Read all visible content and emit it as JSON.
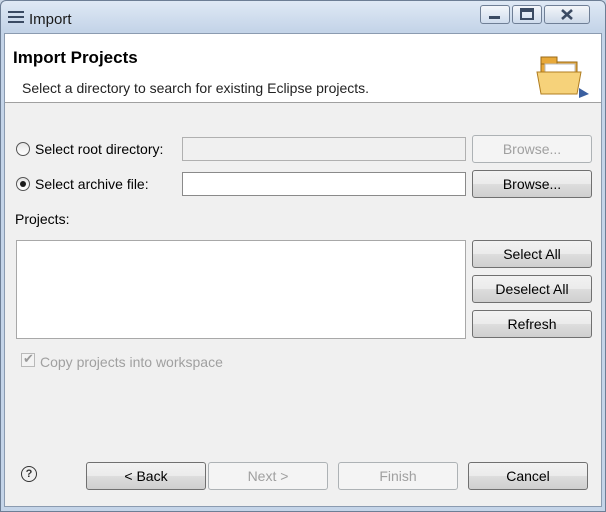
{
  "window": {
    "title": "Import"
  },
  "header": {
    "title": "Import Projects",
    "description": "Select a directory to search for existing Eclipse projects."
  },
  "root_directory": {
    "label": "Select root directory:",
    "selected": false,
    "value": "",
    "browse_label": "Browse..."
  },
  "archive_file": {
    "label": "Select archive file:",
    "selected": true,
    "value": "",
    "browse_label": "Browse..."
  },
  "projects": {
    "label": "Projects:",
    "items": [],
    "select_all_label": "Select All",
    "deselect_all_label": "Deselect All",
    "refresh_label": "Refresh"
  },
  "copy_projects": {
    "label": "Copy projects into workspace",
    "checked": true,
    "enabled": false
  },
  "footer": {
    "help_glyph": "?",
    "back_label": "< Back",
    "next_label": "Next >",
    "finish_label": "Finish",
    "cancel_label": "Cancel"
  }
}
